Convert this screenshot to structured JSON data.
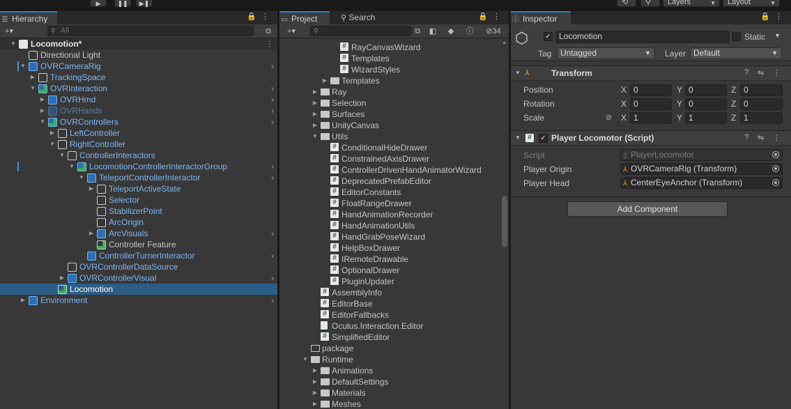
{
  "toolbar": {
    "layers_label": "Layers",
    "layout_label": "Layout",
    "play_icon": "play-icon",
    "pause_icon": "pause-icon",
    "step_icon": "step-icon"
  },
  "hierarchy": {
    "tab_label": "Hierarchy",
    "search_placeholder": "All",
    "rows": [
      {
        "label": "Locomotion*",
        "depth": 0,
        "arrow": "open",
        "icon": "unity",
        "style": "scene",
        "menu": true
      },
      {
        "label": "Directional Light",
        "depth": 1,
        "arrow": "none",
        "icon": "cube",
        "style": "normal"
      },
      {
        "label": "OVRCameraRig",
        "depth": 1,
        "arrow": "open",
        "icon": "prefab",
        "style": "prefab",
        "chevron": true,
        "marker": true
      },
      {
        "label": "TrackingSpace",
        "depth": 2,
        "arrow": "closed",
        "icon": "cube",
        "style": "prefab"
      },
      {
        "label": "OVRInteraction",
        "depth": 2,
        "arrow": "open",
        "icon": "prefab-plus",
        "style": "prefab",
        "chevron": true
      },
      {
        "label": "OVRHmd",
        "depth": 3,
        "arrow": "closed",
        "icon": "prefab",
        "style": "prefab",
        "chevron": true
      },
      {
        "label": "OVRHands",
        "depth": 3,
        "arrow": "closed",
        "icon": "prefab-dim",
        "style": "prefab-dim",
        "chevron": true
      },
      {
        "label": "OVRControllers",
        "depth": 3,
        "arrow": "open",
        "icon": "prefab-plus",
        "style": "prefab",
        "chevron": true
      },
      {
        "label": "LeftController",
        "depth": 4,
        "arrow": "closed",
        "icon": "cube",
        "style": "prefab"
      },
      {
        "label": "RightController",
        "depth": 4,
        "arrow": "open",
        "icon": "cube",
        "style": "prefab"
      },
      {
        "label": "ControllerInteractors",
        "depth": 5,
        "arrow": "open",
        "icon": "cube",
        "style": "prefab"
      },
      {
        "label": "LocomotionControllerInteractorGroup",
        "depth": 6,
        "arrow": "open",
        "icon": "prefab-plus",
        "style": "prefab",
        "chevron": true,
        "marker": true
      },
      {
        "label": "TeleportControllerInteractor",
        "depth": 7,
        "arrow": "open",
        "icon": "prefab",
        "style": "prefab",
        "chevron": true
      },
      {
        "label": "TeleportActiveState",
        "depth": 8,
        "arrow": "closed",
        "icon": "cube",
        "style": "prefab"
      },
      {
        "label": "Selector",
        "depth": 8,
        "arrow": "none",
        "icon": "cube",
        "style": "prefab"
      },
      {
        "label": "StabilizerPoint",
        "depth": 8,
        "arrow": "none",
        "icon": "cube",
        "style": "prefab"
      },
      {
        "label": "ArcOrigin",
        "depth": 8,
        "arrow": "none",
        "icon": "cube",
        "style": "prefab"
      },
      {
        "label": "ArcVisuals",
        "depth": 8,
        "arrow": "closed",
        "icon": "prefab",
        "style": "prefab",
        "chevron": true
      },
      {
        "label": "Controller Feature",
        "depth": 8,
        "arrow": "none",
        "icon": "cube-plus",
        "style": "normal"
      },
      {
        "label": "ControllerTurnerInteractor",
        "depth": 7,
        "arrow": "none",
        "icon": "prefab",
        "style": "prefab",
        "chevron": true
      },
      {
        "label": "OVRControllerDataSource",
        "depth": 5,
        "arrow": "none",
        "icon": "cube",
        "style": "prefab"
      },
      {
        "label": "OVRControllerVisual",
        "depth": 5,
        "arrow": "closed",
        "icon": "prefab",
        "style": "prefab",
        "chevron": true
      },
      {
        "label": "Locomotion",
        "depth": 4,
        "arrow": "none",
        "icon": "cube-plus",
        "style": "selected"
      },
      {
        "label": "Environment",
        "depth": 1,
        "arrow": "closed",
        "icon": "prefab",
        "style": "prefab",
        "chevron": true
      }
    ]
  },
  "project": {
    "tab_label": "Project",
    "search_tab_label": "Search",
    "hidden_count": "34",
    "rows": [
      {
        "label": "RayCanvasWizard",
        "depth": 3,
        "arrow": "none",
        "icon": "script"
      },
      {
        "label": "Templates",
        "depth": 3,
        "arrow": "none",
        "icon": "script"
      },
      {
        "label": "WizardStyles",
        "depth": 3,
        "arrow": "none",
        "icon": "script"
      },
      {
        "label": "Templates",
        "depth": 2,
        "arrow": "closed",
        "icon": "folder"
      },
      {
        "label": "Ray",
        "depth": 1,
        "arrow": "closed",
        "icon": "folder"
      },
      {
        "label": "Selection",
        "depth": 1,
        "arrow": "closed",
        "icon": "folder"
      },
      {
        "label": "Surfaces",
        "depth": 1,
        "arrow": "closed",
        "icon": "folder"
      },
      {
        "label": "UnityCanvas",
        "depth": 1,
        "arrow": "closed",
        "icon": "folder"
      },
      {
        "label": "Utils",
        "depth": 1,
        "arrow": "open",
        "icon": "folder"
      },
      {
        "label": "ConditionalHideDrawer",
        "depth": 2,
        "arrow": "none",
        "icon": "script"
      },
      {
        "label": "ConstrainedAxisDrawer",
        "depth": 2,
        "arrow": "none",
        "icon": "script"
      },
      {
        "label": "ControllerDrivenHandAnimatorWizard",
        "depth": 2,
        "arrow": "none",
        "icon": "script"
      },
      {
        "label": "DeprecatedPrefabEditor",
        "depth": 2,
        "arrow": "none",
        "icon": "script"
      },
      {
        "label": "EditorConstants",
        "depth": 2,
        "arrow": "none",
        "icon": "script"
      },
      {
        "label": "FloatRangeDrawer",
        "depth": 2,
        "arrow": "none",
        "icon": "script"
      },
      {
        "label": "HandAnimationRecorder",
        "depth": 2,
        "arrow": "none",
        "icon": "script"
      },
      {
        "label": "HandAnimationUtils",
        "depth": 2,
        "arrow": "none",
        "icon": "script"
      },
      {
        "label": "HandGrabPoseWizard",
        "depth": 2,
        "arrow": "none",
        "icon": "script"
      },
      {
        "label": "HelpBoxDrawer",
        "depth": 2,
        "arrow": "none",
        "icon": "script"
      },
      {
        "label": "IRemoteDrawable",
        "depth": 2,
        "arrow": "none",
        "icon": "script"
      },
      {
        "label": "OptionalDrawer",
        "depth": 2,
        "arrow": "none",
        "icon": "script"
      },
      {
        "label": "PluginUpdater",
        "depth": 2,
        "arrow": "none",
        "icon": "script"
      },
      {
        "label": "AssemblyInfo",
        "depth": 1,
        "arrow": "none",
        "icon": "script"
      },
      {
        "label": "EditorBase",
        "depth": 1,
        "arrow": "none",
        "icon": "script"
      },
      {
        "label": "EditorFallbacks",
        "depth": 1,
        "arrow": "none",
        "icon": "script"
      },
      {
        "label": "Oculus.Interaction.Editor",
        "depth": 1,
        "arrow": "none",
        "icon": "asmdef"
      },
      {
        "label": "SimplifiedEditor",
        "depth": 1,
        "arrow": "none",
        "icon": "script"
      },
      {
        "label": "package",
        "depth": 0,
        "arrow": "none",
        "icon": "folder-empty"
      },
      {
        "label": "Runtime",
        "depth": 0,
        "arrow": "open",
        "icon": "folder"
      },
      {
        "label": "Animations",
        "depth": 1,
        "arrow": "closed",
        "icon": "folder"
      },
      {
        "label": "DefaultSettings",
        "depth": 1,
        "arrow": "closed",
        "icon": "folder"
      },
      {
        "label": "Materials",
        "depth": 1,
        "arrow": "closed",
        "icon": "folder"
      },
      {
        "label": "Meshes",
        "depth": 1,
        "arrow": "closed",
        "icon": "folder"
      }
    ]
  },
  "inspector": {
    "tab_label": "Inspector",
    "object_name": "Locomotion",
    "static_label": "Static",
    "tag_label": "Tag",
    "tag_value": "Untagged",
    "layer_label": "Layer",
    "layer_value": "Default",
    "transform": {
      "title": "Transform",
      "position_label": "Position",
      "rotation_label": "Rotation",
      "scale_label": "Scale",
      "position": {
        "x": "0",
        "y": "0",
        "z": "0"
      },
      "rotation": {
        "x": "0",
        "y": "0",
        "z": "0"
      },
      "scale": {
        "x": "1",
        "y": "1",
        "z": "1"
      },
      "axis_x": "X",
      "axis_y": "Y",
      "axis_z": "Z"
    },
    "script_component": {
      "title": "Player Locomotor (Script)",
      "script_label": "Script",
      "script_value": "PlayerLocomotor",
      "origin_label": "Player Origin",
      "origin_value": "OVRCameraRig (Transform)",
      "head_label": "Player Head",
      "head_value": "CenterEyeAnchor (Transform)"
    },
    "add_component_label": "Add Component"
  },
  "colors": {
    "accent": "#3a79bb",
    "selection": "#2c5d87",
    "prefab_text": "#7cb6f2",
    "panel_bg": "#383838"
  }
}
